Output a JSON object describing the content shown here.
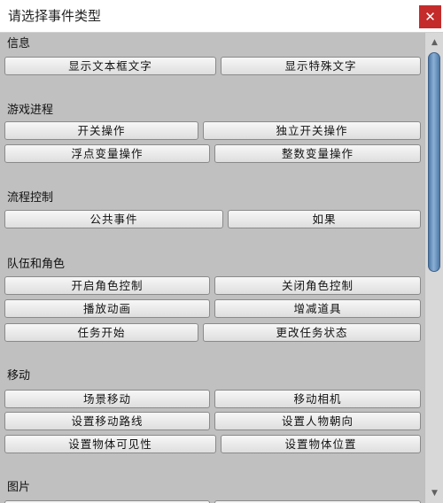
{
  "window": {
    "title": "请选择事件类型",
    "close_glyph": "✕"
  },
  "sections": [
    {
      "title": "信息",
      "rows": [
        [
          "显示文本框文字",
          "显示特殊文字"
        ]
      ]
    },
    {
      "title": "游戏进程",
      "rows": [
        [
          "开关操作",
          "独立开关操作"
        ],
        [
          "浮点变量操作",
          "整数变量操作"
        ]
      ]
    },
    {
      "title": "流程控制",
      "rows": [
        [
          "公共事件",
          "如果"
        ]
      ]
    },
    {
      "title": "队伍和角色",
      "rows": [
        [
          "开启角色控制",
          "关闭角色控制"
        ],
        [
          "播放动画",
          "增减道具"
        ],
        [
          "任务开始",
          "更改任务状态"
        ]
      ]
    },
    {
      "title": "移动",
      "rows": [
        [
          "场景移动",
          "移动相机"
        ],
        [
          "设置移动路线",
          "设置人物朝向"
        ],
        [
          "设置物体可见性",
          "设置物体位置"
        ]
      ]
    },
    {
      "title": "图片",
      "rows": []
    }
  ],
  "scrollbar": {
    "up_glyph": "▲",
    "down_glyph": "▼"
  }
}
